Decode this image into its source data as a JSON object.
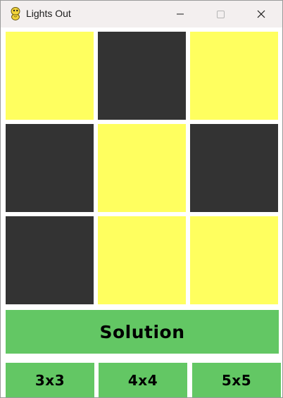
{
  "window": {
    "title": "Lights Out",
    "icon": "python-snake-icon"
  },
  "grid": {
    "size": "3x3",
    "cells": [
      [
        "on",
        "off",
        "on"
      ],
      [
        "off",
        "on",
        "off"
      ],
      [
        "off",
        "on",
        "on"
      ]
    ],
    "on_color": "#ffff5f",
    "off_color": "#333333"
  },
  "buttons": {
    "solution": "Solution",
    "size_3": "3x3",
    "size_4": "4x4",
    "size_5": "5x5",
    "color": "#63c764"
  }
}
